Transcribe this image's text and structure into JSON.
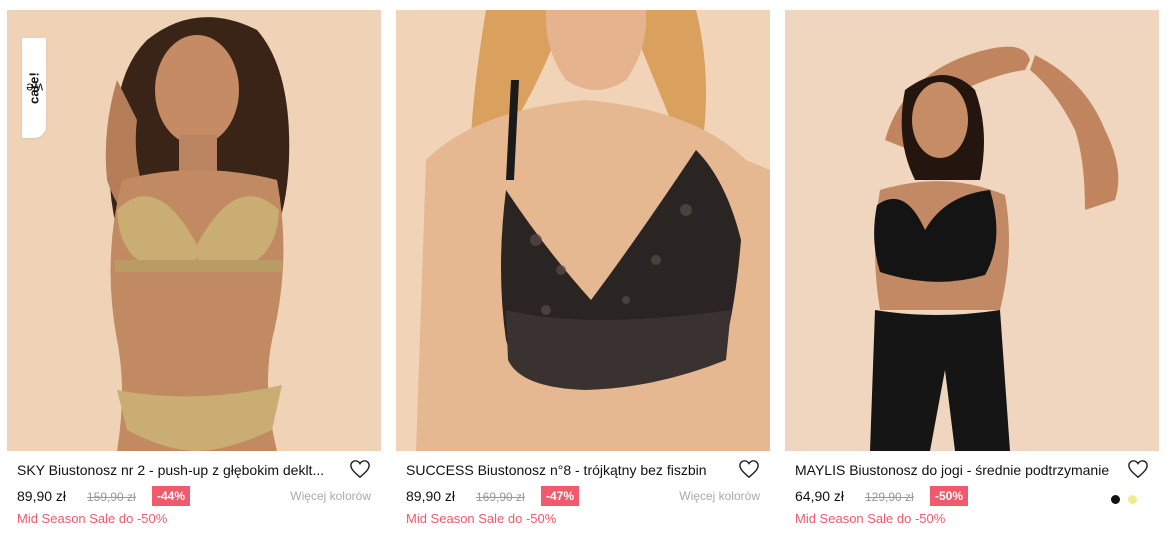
{
  "products": [
    {
      "title": "SKY Biustonosz nr 2 - push-up z głębokim deklt...",
      "price": "89,90 zł",
      "old_price": "159,90 zł",
      "discount": "-44%",
      "more_colors": "Więcej kolorów",
      "promo": "Mid Season Sale do -50%",
      "badge_prefix": "we",
      "badge_bold": "care!",
      "photo": "woman-in-gold-lace-push-up-bra-and-briefs"
    },
    {
      "title": "SUCCESS Biustonosz n°8 - trójkątny bez fiszbin",
      "price": "89,90 zł",
      "old_price": "169,90 zł",
      "discount": "-47%",
      "more_colors": "Więcej kolorów",
      "promo": "Mid Season Sale do -50%",
      "photo": "black-lace-triangle-bralette"
    },
    {
      "title": "MAYLIS Biustonosz do jogi - średnie podtrzymanie",
      "price": "64,90 zł",
      "old_price": "129,90 zł",
      "discount": "-50%",
      "promo": "Mid Season Sale do -50%",
      "swatches": [
        "#111111",
        "#f2ec8a"
      ],
      "photo": "woman-in-black-yoga-bra-and-leggings"
    }
  ],
  "icons": {
    "favorite": "heart-outline-icon"
  },
  "colors": {
    "sale": "#f05a6c",
    "background_photo": "#f1d6bd"
  }
}
